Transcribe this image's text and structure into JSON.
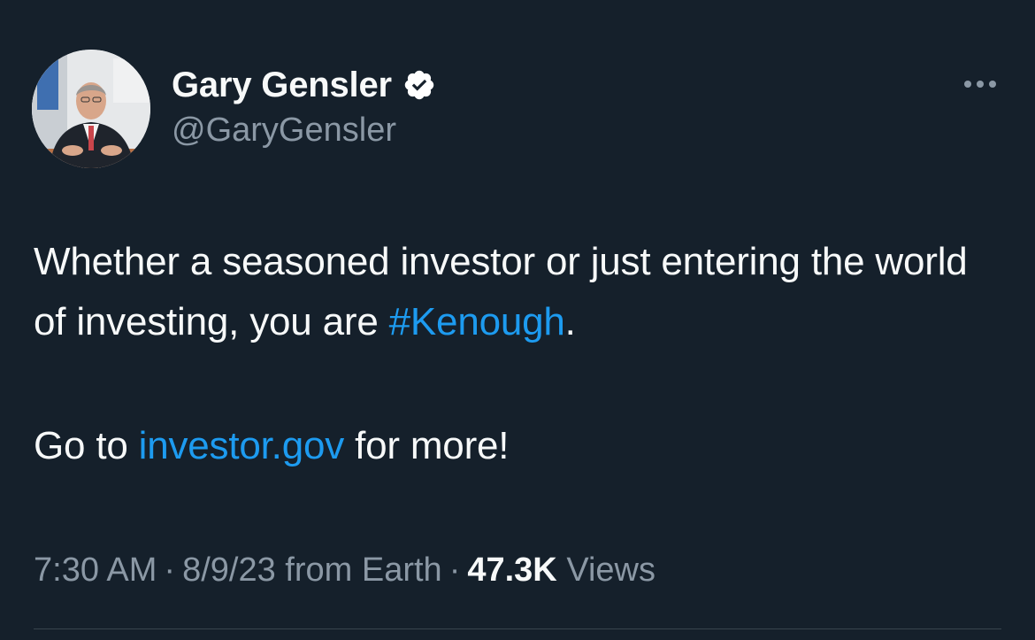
{
  "author": {
    "display_name": "Gary Gensler",
    "handle": "@GaryGensler",
    "verified_icon": "verified-badge-icon",
    "avatar_icon": "profile-photo"
  },
  "menu": {
    "more_icon": "more-options-icon"
  },
  "tweet": {
    "line1_text": "Whether a seasoned investor or just entering the world of investing, you are ",
    "hashtag": "#Kenough",
    "line1_end": ".",
    "line2_prefix": "Go to ",
    "line2_link": "investor.gov",
    "line2_suffix": " for more!"
  },
  "meta": {
    "time": "7:30 AM",
    "separator": "·",
    "date": "8/9/23",
    "source": "from Earth",
    "views_count": "47.3K",
    "views_label": "Views"
  },
  "colors": {
    "background": "#15202b",
    "text": "#f7f9f9",
    "secondary": "#8b98a5",
    "link": "#1d9bf0",
    "verified": "#ffffff"
  }
}
